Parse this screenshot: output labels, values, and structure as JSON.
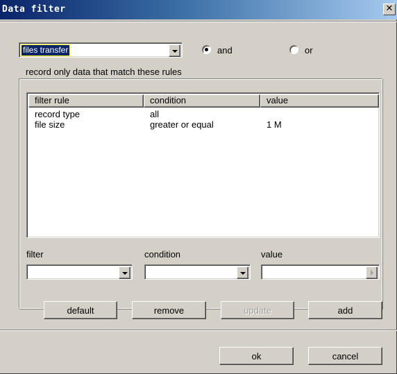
{
  "window": {
    "title": "Data filter",
    "close_glyph": "✕"
  },
  "preset": {
    "selected": "files transfer"
  },
  "logic": {
    "and_label": "and",
    "or_label": "or",
    "selected": "and"
  },
  "group": {
    "caption": "record only data that match these rules"
  },
  "table": {
    "columns": [
      "filter rule",
      "condition",
      "value"
    ],
    "rows": [
      [
        "record type",
        "all",
        ""
      ],
      [
        "file size",
        "greater or equal",
        "1 M"
      ]
    ]
  },
  "editor": {
    "filter_label": "filter",
    "condition_label": "condition",
    "value_label": "value",
    "filter_value": "",
    "condition_value": "",
    "value_value": ""
  },
  "buttons": {
    "default": "default",
    "remove": "remove",
    "update": "update",
    "add": "add",
    "ok": "ok",
    "cancel": "cancel"
  },
  "icons": {
    "close": "close-icon",
    "dropdown": "chevron-down-icon",
    "value_picker": "chevron-right-icon"
  }
}
